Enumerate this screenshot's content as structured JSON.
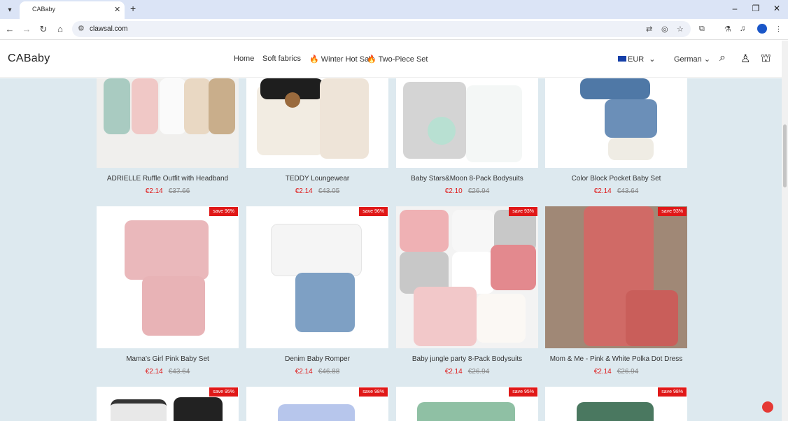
{
  "browser": {
    "tab_title": "CABaby",
    "url": "clawsal.com"
  },
  "site": {
    "logo": "CABaby",
    "nav": [
      "Home",
      "Soft fabrics",
      "Winter Hot Sale",
      "Two-Piece Set"
    ],
    "currency": "EUR",
    "language": "German"
  },
  "products": [
    {
      "name": "ADRIELLE Ruffle Outfit with Headband",
      "price": "€2.14",
      "original": "€37.66",
      "badge": ""
    },
    {
      "name": "TEDDY Loungewear",
      "price": "€2.14",
      "original": "€43.05",
      "badge": ""
    },
    {
      "name": "Baby Stars&Moon 8-Pack Bodysuits",
      "price": "€2.10",
      "original": "€26.94",
      "badge": ""
    },
    {
      "name": "Color Block Pocket Baby Set",
      "price": "€2.14",
      "original": "€43.64",
      "badge": ""
    },
    {
      "name": "Mama's Girl Pink Baby Set",
      "price": "€2.14",
      "original": "€43.64",
      "badge": "save 96%"
    },
    {
      "name": "Denim Baby Romper",
      "price": "€2.14",
      "original": "€46.88",
      "badge": "save 96%"
    },
    {
      "name": "Baby jungle party 8-Pack Bodysuits",
      "price": "€2.14",
      "original": "€26.94",
      "badge": "save 93%"
    },
    {
      "name": "Mom & Me - Pink & White Polka Dot Dress",
      "price": "€2.14",
      "original": "€26.94",
      "badge": "save 93%"
    },
    {
      "badge": "save 95%"
    },
    {
      "badge": "save 98%"
    },
    {
      "badge": "save 95%"
    },
    {
      "badge": "save 98%"
    }
  ],
  "colors": {
    "content_bg": "#dde9ef",
    "price_red": "#e01818",
    "badge_red": "#e01818",
    "tabbar_bg": "#dbe4f6"
  },
  "icons": [
    "tab-search-icon",
    "close-icon",
    "plus-icon",
    "minimize-icon",
    "maximize-icon",
    "back-icon",
    "forward-icon",
    "reload-icon",
    "home-icon",
    "site-info-icon",
    "translate-icon",
    "eye-off-icon",
    "star-icon",
    "extensions-icon",
    "flask-icon",
    "media-icon",
    "profile-icon",
    "menu-icon",
    "search-icon",
    "user-icon",
    "bag-icon",
    "chat-icon"
  ]
}
